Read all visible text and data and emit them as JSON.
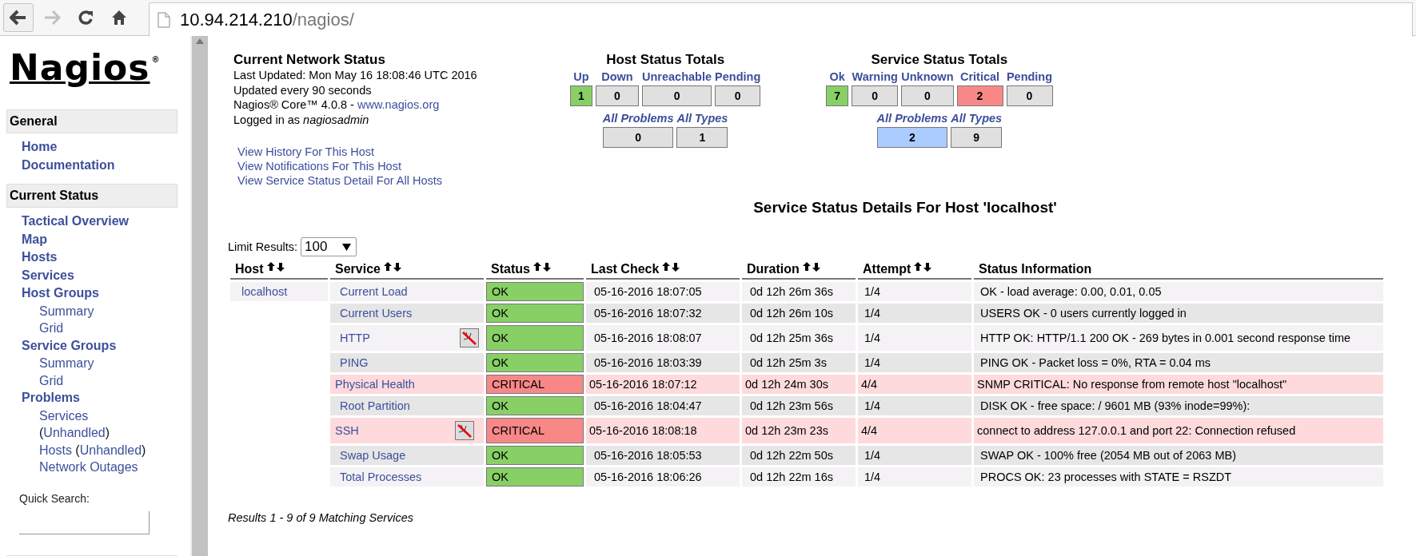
{
  "browser": {
    "back_disabled": false,
    "forward_disabled": true,
    "url_host": "10.94.214.210",
    "url_path": "/nagios/"
  },
  "sidebar": {
    "logo": "Nagios",
    "logo_mark": "®",
    "sections": [
      {
        "title": "General",
        "items": [
          {
            "label": "Home"
          },
          {
            "label": "Documentation"
          }
        ]
      },
      {
        "title": "Current Status",
        "items": [
          {
            "label": "Tactical Overview"
          },
          {
            "label": "Map"
          },
          {
            "label": "Hosts"
          },
          {
            "label": "Services"
          },
          {
            "label": "Host Groups",
            "children": [
              {
                "parts": [
                  {
                    "text": "Summary",
                    "kind": "link"
                  }
                ]
              },
              {
                "parts": [
                  {
                    "text": "Grid",
                    "kind": "link"
                  }
                ]
              }
            ]
          },
          {
            "label": "Service Groups",
            "children": [
              {
                "parts": [
                  {
                    "text": "Summary",
                    "kind": "link"
                  }
                ]
              },
              {
                "parts": [
                  {
                    "text": "Grid",
                    "kind": "link"
                  }
                ]
              }
            ]
          },
          {
            "label": "Problems",
            "children": [
              {
                "parts": [
                  {
                    "text": "Services",
                    "kind": "link",
                    "line_break": true
                  },
                  {
                    "text": "(",
                    "kind": "plain"
                  },
                  {
                    "text": "Unhandled",
                    "kind": "link"
                  },
                  {
                    "text": ")",
                    "kind": "plain"
                  }
                ]
              },
              {
                "parts": [
                  {
                    "text": "Hosts",
                    "kind": "link"
                  },
                  {
                    "text": "(",
                    "kind": "plain",
                    "space_before": true
                  },
                  {
                    "text": "Unhandled",
                    "kind": "link"
                  },
                  {
                    "text": ")",
                    "kind": "plain"
                  }
                ]
              },
              {
                "parts": [
                  {
                    "text": "Network Outages",
                    "kind": "link"
                  }
                ]
              }
            ]
          }
        ]
      }
    ],
    "quick_search": {
      "label": "Quick Search:"
    }
  },
  "status_info": {
    "title": "Current Network Status",
    "lines": [
      "Last Updated: Mon May 16 18:08:46 UTC 2016",
      "Updated every 90 seconds"
    ],
    "version": "Nagios® Core™ 4.0.8 - ",
    "version_link": "www.nagios.org",
    "login_prefix": "Logged in as ",
    "login_user": "nagiosadmin",
    "links": [
      "View History For This Host",
      "View Notifications For This Host",
      "View Service Status Detail For All Hosts"
    ]
  },
  "host_totals": {
    "title": "Host Status Totals",
    "counts": [
      {
        "label": "Up",
        "value": "1",
        "color": "#88d066"
      },
      {
        "label": "Down",
        "value": "0",
        "color": "#e0e0e0"
      },
      {
        "label": "Unreachable",
        "value": "0",
        "color": "#e0e0e0"
      },
      {
        "label": "Pending",
        "value": "0",
        "color": "#e0e0e0"
      }
    ],
    "summary": [
      {
        "label": "All Problems",
        "value": "0",
        "color": "#e0e0e0"
      },
      {
        "label": "All Types",
        "value": "1",
        "color": "#e0e0e0"
      }
    ]
  },
  "service_totals": {
    "title": "Service Status Totals",
    "counts": [
      {
        "label": "Ok",
        "value": "7",
        "color": "#88d066"
      },
      {
        "label": "Warning",
        "value": "0",
        "color": "#e0e0e0"
      },
      {
        "label": "Unknown",
        "value": "0",
        "color": "#e0e0e0"
      },
      {
        "label": "Critical",
        "value": "2",
        "color": "#f88888"
      },
      {
        "label": "Pending",
        "value": "0",
        "color": "#e0e0e0"
      }
    ],
    "summary": [
      {
        "label": "All Problems",
        "value": "2",
        "color": "#aaccff"
      },
      {
        "label": "All Types",
        "value": "9",
        "color": "#e0e0e0"
      }
    ]
  },
  "page_title": "Service Status Details For Host 'localhost'",
  "limit": {
    "label": "Limit Results:",
    "value": "100"
  },
  "table": {
    "columns": [
      {
        "label": "Host",
        "sortable": true
      },
      {
        "label": "Service",
        "sortable": true
      },
      {
        "label": "Status",
        "sortable": true
      },
      {
        "label": "Last Check",
        "sortable": true
      },
      {
        "label": "Duration",
        "sortable": true
      },
      {
        "label": "Attempt",
        "sortable": true
      },
      {
        "label": "Status Information",
        "sortable": false
      }
    ],
    "host": "localhost",
    "rows": [
      {
        "service": "Current Load",
        "status": "OK",
        "kind": "ok",
        "notifications_disabled": false,
        "last_check": "05-16-2016 18:07:05",
        "duration": "0d 12h 26m 36s",
        "attempt": "1/4",
        "info": "OK - load average: 0.00, 0.01, 0.05"
      },
      {
        "service": "Current Users",
        "status": "OK",
        "kind": "ok",
        "notifications_disabled": false,
        "last_check": "05-16-2016 18:07:32",
        "duration": "0d 12h 26m 10s",
        "attempt": "1/4",
        "info": "USERS OK - 0 users currently logged in"
      },
      {
        "service": "HTTP",
        "status": "OK",
        "kind": "ok",
        "notifications_disabled": true,
        "last_check": "05-16-2016 18:08:07",
        "duration": "0d 12h 25m 36s",
        "attempt": "1/4",
        "info": "HTTP OK: HTTP/1.1 200 OK - 269 bytes in 0.001 second response time"
      },
      {
        "service": "PING",
        "status": "OK",
        "kind": "ok",
        "notifications_disabled": false,
        "last_check": "05-16-2016 18:03:39",
        "duration": "0d 12h 25m 3s",
        "attempt": "1/4",
        "info": "PING OK - Packet loss = 0%, RTA = 0.04 ms"
      },
      {
        "service": "Physical Health",
        "status": "CRITICAL",
        "kind": "critical",
        "notifications_disabled": false,
        "last_check": "05-16-2016 18:07:12",
        "duration": "0d 12h 24m 30s",
        "attempt": "4/4",
        "info": "SNMP CRITICAL: No response from remote host \"localhost\""
      },
      {
        "service": "Root Partition",
        "status": "OK",
        "kind": "ok",
        "notifications_disabled": false,
        "last_check": "05-16-2016 18:04:47",
        "duration": "0d 12h 23m 56s",
        "attempt": "1/4",
        "info": "DISK OK - free space: / 9601 MB (93% inode=99%):"
      },
      {
        "service": "SSH",
        "status": "CRITICAL",
        "kind": "critical",
        "notifications_disabled": true,
        "last_check": "05-16-2016 18:08:18",
        "duration": "0d 12h 23m 23s",
        "attempt": "4/4",
        "info": "connect to address 127.0.0.1 and port 22: Connection refused"
      },
      {
        "service": "Swap Usage",
        "status": "OK",
        "kind": "ok",
        "notifications_disabled": false,
        "last_check": "05-16-2016 18:05:53",
        "duration": "0d 12h 22m 50s",
        "attempt": "1/4",
        "info": "SWAP OK - 100% free (2054 MB out of 2063 MB)"
      },
      {
        "service": "Total Processes",
        "status": "OK",
        "kind": "ok",
        "notifications_disabled": false,
        "last_check": "05-16-2016 18:06:26",
        "duration": "0d 12h 22m 16s",
        "attempt": "1/4",
        "info": "PROCS OK: 23 processes with STATE = RSZDT"
      }
    ]
  },
  "results": "Results 1 - 9 of 9 Matching Services"
}
